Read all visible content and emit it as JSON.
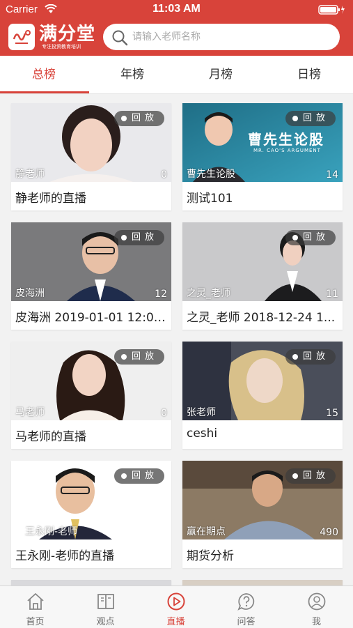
{
  "status_bar": {
    "carrier": "Carrier",
    "time": "11:03 AM"
  },
  "header": {
    "logo_title": "满分堂",
    "logo_subtitle": "专注投资教育培训",
    "search_placeholder": "请输入老师名称"
  },
  "tabs": [
    {
      "label": "总榜",
      "active": true
    },
    {
      "label": "年榜",
      "active": false
    },
    {
      "label": "月榜",
      "active": false
    },
    {
      "label": "日榜",
      "active": false
    }
  ],
  "cards": [
    {
      "thumb_name": "静老师",
      "count": "0",
      "badge": "回放",
      "title": "静老师的直播"
    },
    {
      "thumb_name": "曹先生论股",
      "count": "14",
      "badge": "回放",
      "title": "测试101",
      "banner_title": "曹先生论股",
      "banner_subtitle": "MR. CAO'S ARGUMENT"
    },
    {
      "thumb_name": "皮海洲",
      "count": "12",
      "badge": "回放",
      "title": "皮海洲 2019-01-01 12:00..."
    },
    {
      "thumb_name": "之灵_老师",
      "count": "11",
      "badge": "回放",
      "title": "之灵_老师 2018-12-24 1..."
    },
    {
      "thumb_name": "马老师",
      "count": "0",
      "badge": "回放",
      "title": "马老师的直播"
    },
    {
      "thumb_name": "张老师",
      "count": "15",
      "badge": "回放",
      "title": "ceshi"
    },
    {
      "thumb_name": "王永刚-老师",
      "count": "",
      "badge": "回放",
      "title": "王永刚-老师的直播"
    },
    {
      "thumb_name": "赢在期点",
      "count": "490",
      "badge": "回放",
      "title": "期货分析"
    }
  ],
  "tab_bar": [
    {
      "label": "首页",
      "icon": "home-icon",
      "active": false
    },
    {
      "label": "观点",
      "icon": "book-icon",
      "active": false
    },
    {
      "label": "直播",
      "icon": "play-circle-icon",
      "active": true
    },
    {
      "label": "问答",
      "icon": "question-icon",
      "active": false
    },
    {
      "label": "我",
      "icon": "user-icon",
      "active": false
    }
  ],
  "colors": {
    "brand": "#d8433a",
    "badge_bg": "#3c3c3c",
    "tab_inactive": "#666666"
  }
}
